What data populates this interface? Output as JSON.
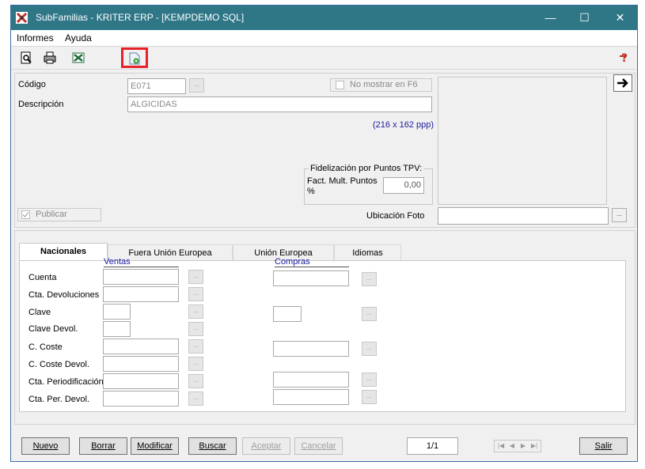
{
  "window": {
    "title": "SubFamilias - KRITER ERP - [KEMPDEMO SQL]"
  },
  "titlebar": {
    "minimize": "—",
    "maximize": "☐",
    "close": "✕"
  },
  "menu": {
    "items": [
      "Informes",
      "Ayuda"
    ]
  },
  "toolbar": {
    "icons": [
      "print-preview-icon",
      "print-icon",
      "excel-export-icon",
      "export-icon",
      "help-icon"
    ]
  },
  "form": {
    "codigo_label": "Código",
    "codigo_value": "E071",
    "descripcion_label": "Descripción",
    "descripcion_value": "ALGICIDAS",
    "no_mostrar_label": "No mostrar en F6",
    "image_size": "(216 x 162 ppp)",
    "fidel_group": "Fidelización por Puntos TPV:",
    "fact_mult_label": "Fact. Mult. Puntos %",
    "fact_mult_value": "0,00",
    "publicar_label": "Publicar",
    "ubicacion_label": "Ubicación Foto",
    "ubicacion_value": "",
    "ellipsis": "..."
  },
  "tabs": [
    {
      "label": "Nacionales",
      "active": true
    },
    {
      "label": "Fuera Unión Europea",
      "active": false
    },
    {
      "label": "Unión Europea",
      "active": false
    },
    {
      "label": "Idiomas",
      "active": false
    }
  ],
  "accounts": {
    "ventas_header": "Ventas",
    "compras_header": "Compras",
    "rows": [
      {
        "label": "Cuenta"
      },
      {
        "label": "Cta. Devoluciones"
      },
      {
        "label": "Clave"
      },
      {
        "label": "Clave Devol."
      },
      {
        "label": "C. Coste"
      },
      {
        "label": "C. Coste Devol."
      },
      {
        "label": "Cta. Periodificación"
      },
      {
        "label": "Cta. Per. Devol."
      }
    ]
  },
  "buttons": {
    "nuevo": "Nuevo",
    "borrar": "Borrar",
    "modificar": "Modificar",
    "buscar": "Buscar",
    "aceptar": "Aceptar",
    "cancelar": "Cancelar",
    "salir": "Salir"
  },
  "record": {
    "position": "1/1"
  },
  "nav": {
    "first": "|◀",
    "prev": "◀",
    "next": "▶",
    "last": "▶|"
  }
}
